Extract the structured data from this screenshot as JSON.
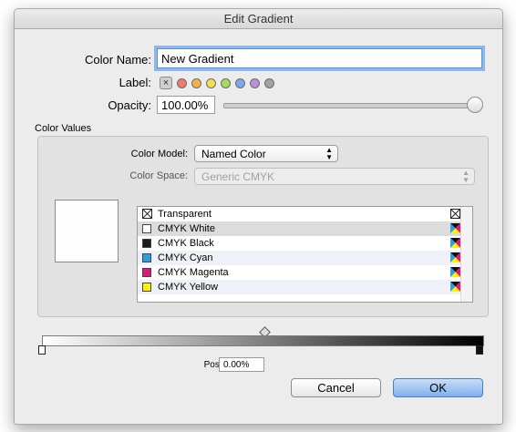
{
  "window": {
    "title": "Edit Gradient"
  },
  "form": {
    "color_name_label": "Color Name:",
    "color_name_value": "New Gradient",
    "label_label": "Label:",
    "label_clear_icon": "×",
    "label_colors": [
      "#f07a6c",
      "#f5b048",
      "#f3de4f",
      "#a8d95a",
      "#7aa7ee",
      "#c08ce0",
      "#a3a3a3"
    ],
    "opacity_label": "Opacity:",
    "opacity_value": "100.00%",
    "opacity_fraction": 1.0
  },
  "color_values": {
    "section_label": "Color Values",
    "color_model_label": "Color Model:",
    "color_model_value": "Named Color",
    "color_space_label": "Color Space:",
    "color_space_value": "Generic CMYK",
    "swatches": [
      {
        "name": "Transparent",
        "chip": "transparent-x",
        "icon": "transparent-x-icon"
      },
      {
        "name": "CMYK White",
        "chip": "#ffffff",
        "icon": "cmyk-icon"
      },
      {
        "name": "CMYK Black",
        "chip": "#1c1c1c",
        "icon": "cmyk-icon"
      },
      {
        "name": "CMYK Cyan",
        "chip": "#2d9fe0",
        "icon": "cmyk-icon"
      },
      {
        "name": "CMYK Magenta",
        "chip": "#e0177d",
        "icon": "cmyk-icon"
      },
      {
        "name": "CMYK Yellow",
        "chip": "#fff200",
        "icon": "cmyk-icon"
      }
    ],
    "selected_index": 1
  },
  "gradient": {
    "position_label": "Position:",
    "position_value": "0.00%",
    "start_color": "#ffffff",
    "end_color": "#000000",
    "midpoint": 0.5
  },
  "buttons": {
    "cancel": "Cancel",
    "ok": "OK"
  }
}
